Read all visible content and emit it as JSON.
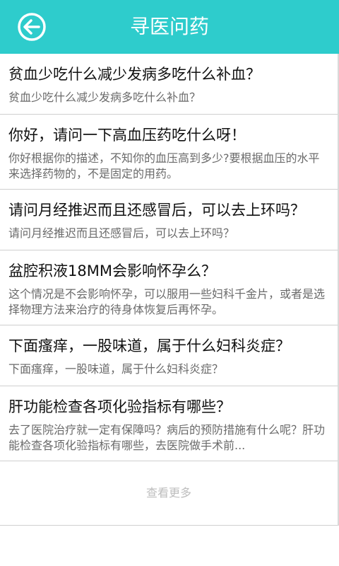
{
  "header": {
    "title": "寻医问药"
  },
  "items": [
    {
      "question": "贫血少吃什么减少发病多吃什么补血？",
      "answer": "贫血少吃什么减少发病多吃什么补血？"
    },
    {
      "question": "你好，请问一下高血压药吃什么呀！",
      "answer": "你好根据你的描述，不知你的血压高到多少?要根据血压的水平来选择药物的，不是固定的用药。"
    },
    {
      "question": "请问月经推迟而且还感冒后，可以去上环吗？",
      "answer": "请问月经推迟而且还感冒后，可以去上环吗？"
    },
    {
      "question": "盆腔积液18MM会影响怀孕么？",
      "answer": "这个情况是不会影响怀孕，可以服用一些妇科千金片，或者是选择物理方法来治疗的待身体恢复后再怀孕。"
    },
    {
      "question": "下面瘙痒，一股味道，属于什么妇科炎症？",
      "answer": "下面瘙痒，一股味道，属于什么妇科炎症？"
    },
    {
      "question": "肝功能检查各项化验指标有哪些？",
      "answer": "去了医院治疗就一定有保障吗？病后的预防措施有什么呢？肝功能检查各项化验指标有哪些，去医院做手术前..."
    }
  ],
  "more_label": "查看更多"
}
